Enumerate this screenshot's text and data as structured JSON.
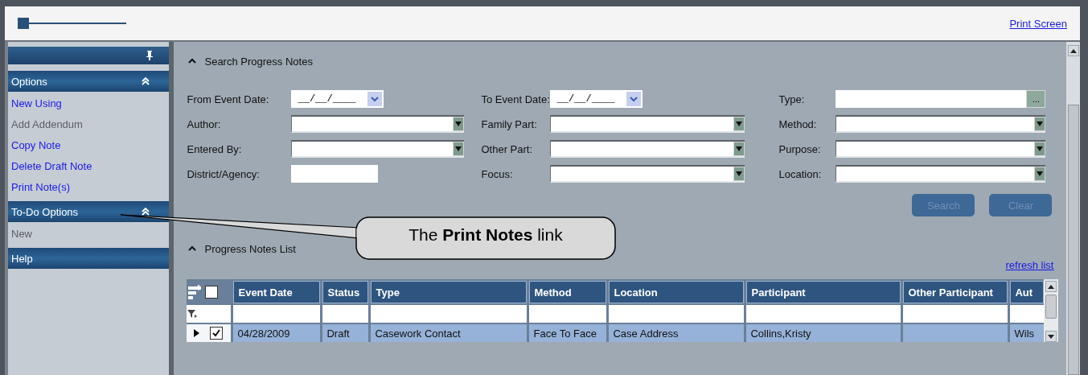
{
  "header": {
    "slider": {
      "level": 0
    },
    "print_screen": "Print Screen"
  },
  "sidebar": {
    "sections": [
      {
        "title": "Options",
        "items": [
          {
            "label": "New Using",
            "disabled": false
          },
          {
            "label": "Add Addendum",
            "disabled": true
          },
          {
            "label": "Copy Note",
            "disabled": false
          },
          {
            "label": "Delete Draft Note",
            "disabled": false
          },
          {
            "label": "Print Note(s)",
            "disabled": false
          }
        ]
      },
      {
        "title": "To-Do Options",
        "items": [
          {
            "label": "New",
            "disabled": true
          }
        ]
      },
      {
        "title": "Help"
      }
    ]
  },
  "search": {
    "title": "Search Progress Notes",
    "columns": [
      [
        {
          "label": "From Event Date:",
          "kind": "date",
          "value": "__/__/____"
        },
        {
          "label": "Author:",
          "kind": "combo"
        },
        {
          "label": "Entered By:",
          "kind": "combo"
        },
        {
          "label": "District/Agency:",
          "kind": "text"
        }
      ],
      [
        {
          "label": "To Event Date:",
          "kind": "date",
          "value": "__/__/____"
        },
        {
          "label": "Family Part:",
          "kind": "combo"
        },
        {
          "label": "Other Part:",
          "kind": "combo"
        },
        {
          "label": "Focus:",
          "kind": "combo"
        }
      ],
      [
        {
          "label": "Type:",
          "kind": "lookup",
          "button": "..."
        },
        {
          "label": "Method:",
          "kind": "combo"
        },
        {
          "label": "Purpose:",
          "kind": "combo"
        },
        {
          "label": "Location:",
          "kind": "combo"
        }
      ]
    ],
    "buttons": [
      {
        "label": "Search",
        "disabled": true
      },
      {
        "label": "Clear",
        "disabled": true
      }
    ]
  },
  "list": {
    "title": "Progress Notes List",
    "refresh": "refresh list",
    "select_all_checked": false,
    "columns": [
      "Event Date",
      "Status",
      "Type",
      "Method",
      "Location",
      "Participant",
      "Other Participant",
      "Aut"
    ],
    "rows": [
      {
        "selected": true,
        "checked": true,
        "cells": [
          "04/28/2009",
          "Draft",
          "Casework Contact",
          "Face To Face",
          "Case Address",
          "Collins,Kristy",
          "",
          "Wils"
        ]
      }
    ]
  },
  "callout": {
    "text": "The **Print Notes** link"
  }
}
